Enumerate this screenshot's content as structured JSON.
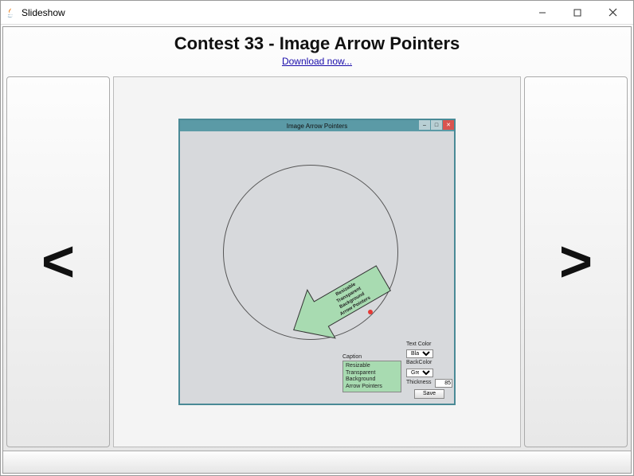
{
  "window": {
    "title": "Slideshow"
  },
  "header": {
    "title": "Contest 33 - Image Arrow Pointers",
    "download_link": "Download now..."
  },
  "nav": {
    "prev": "<",
    "next": ">"
  },
  "slide": {
    "inner_title": "Image Arrow Pointers",
    "arrow_text": [
      "Resizable",
      "Transparent",
      "Background",
      "Arrow Pointers"
    ],
    "caption": {
      "label": "Caption",
      "lines": [
        "Resizable",
        "Transparent",
        "Background",
        "Arrow Pointers"
      ]
    },
    "controls": {
      "text_color": {
        "label": "Text Color",
        "value": "Black"
      },
      "back_color": {
        "label": "BackColor",
        "value": "Green"
      },
      "thickness": {
        "label": "Thickness",
        "value": "85"
      },
      "save": "Save"
    }
  }
}
